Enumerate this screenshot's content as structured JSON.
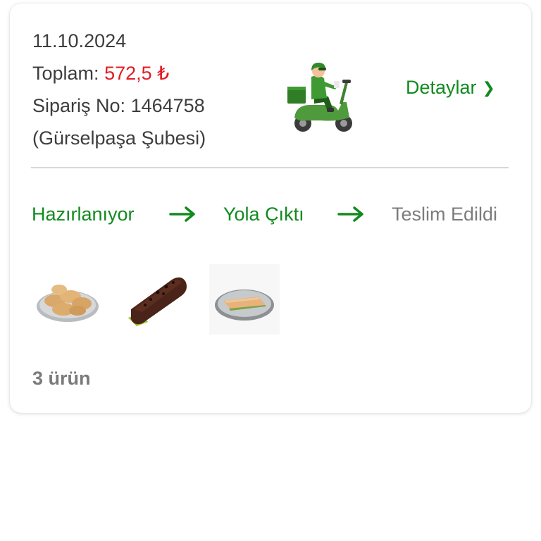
{
  "order": {
    "date": "11.10.2024",
    "total_label": "Toplam:",
    "total_value": "572,5 ₺",
    "order_no_label": "Sipariş No:",
    "order_no_value": "1464758",
    "branch": "(Gürselpaşa Şubesi)",
    "details_label": "Detaylar",
    "details_chevron": "❯",
    "courier_icon": "scooter-courier-icon"
  },
  "status": {
    "steps": [
      {
        "label": "Hazırlanıyor",
        "state": "done"
      },
      {
        "label": "Yola Çıktı",
        "state": "done"
      },
      {
        "label": "Teslim Edildi",
        "state": "pending"
      }
    ],
    "active_color": "#118a1f",
    "pending_color": "#7c7c7c"
  },
  "products": {
    "thumbnails": [
      "pastry-plate-image",
      "chocolate-log-cake-image",
      "borek-plate-image"
    ],
    "count_label": "3 ürün"
  },
  "colors": {
    "accent": "#118a1f",
    "price": "#e31b23"
  }
}
